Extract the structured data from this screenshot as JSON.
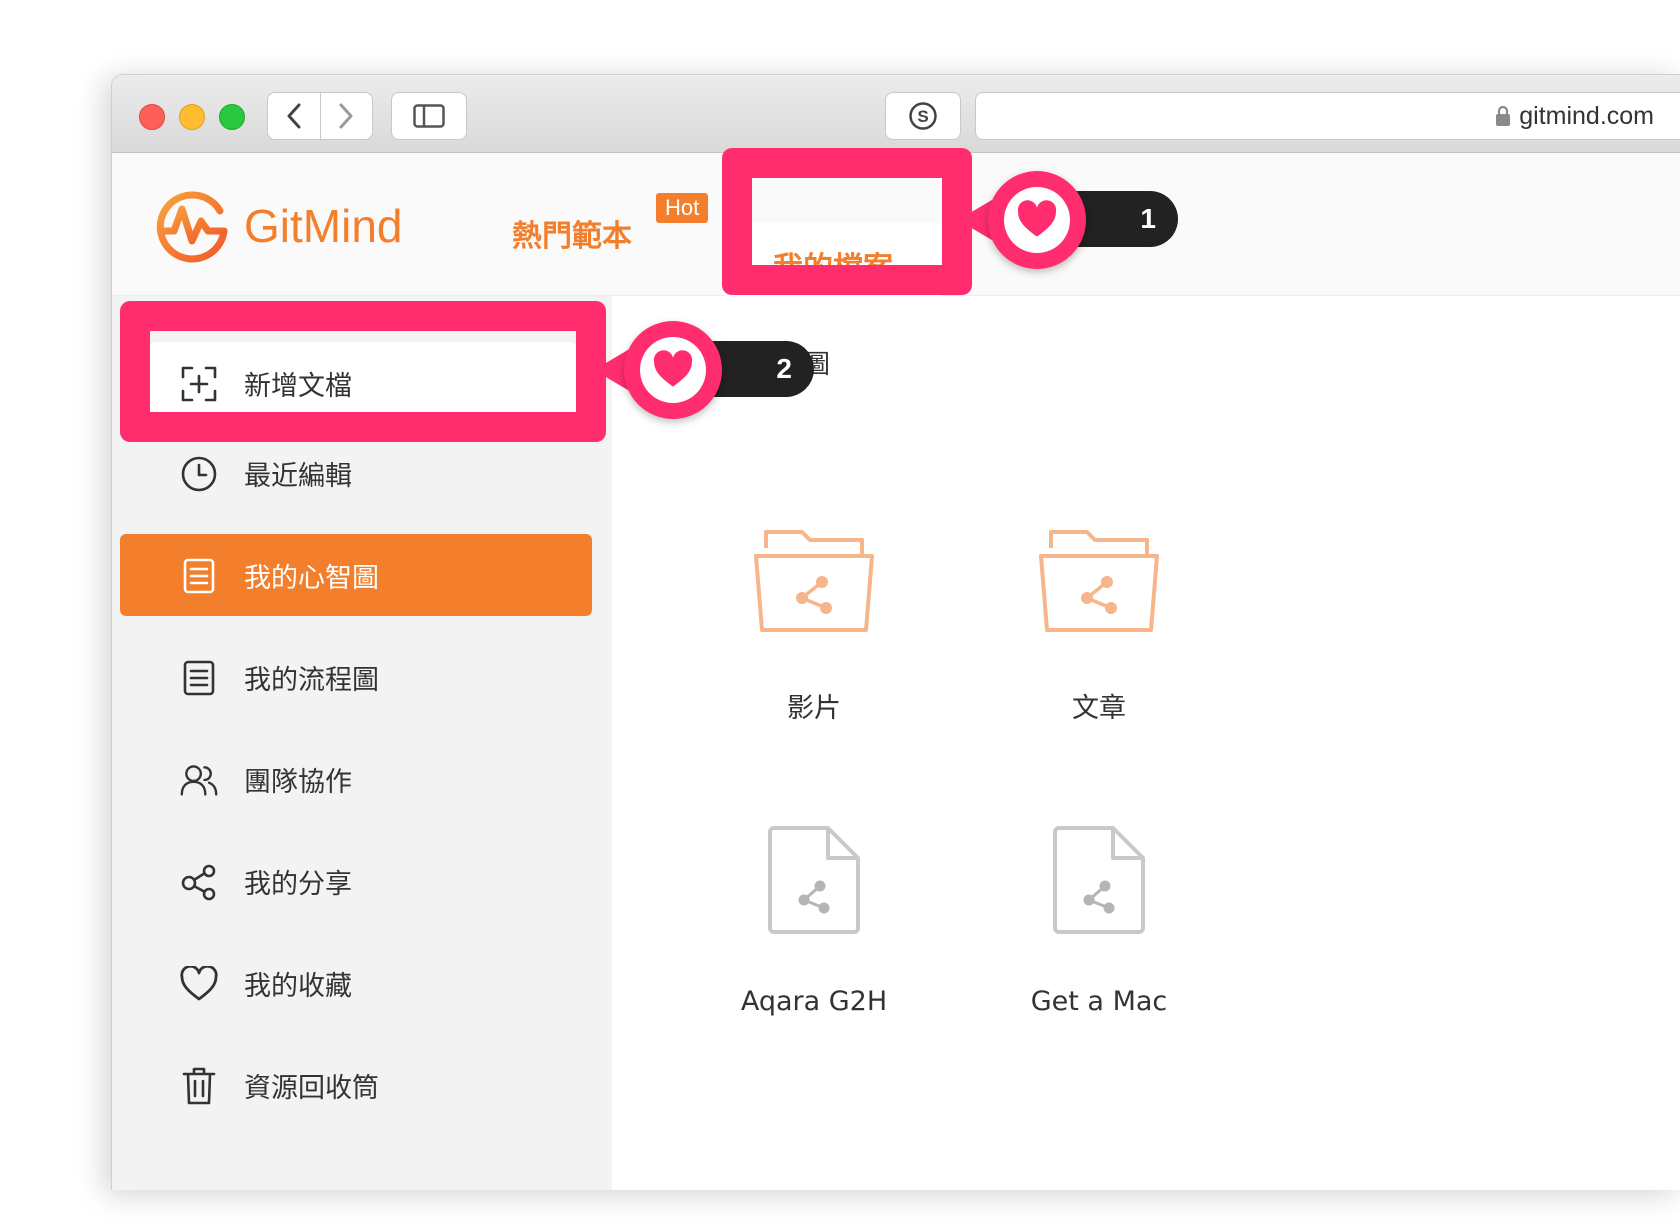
{
  "browser": {
    "url": "gitmind.com"
  },
  "app": {
    "logo_text": "GitMind",
    "nav": {
      "templates": "熱門範本",
      "hot_badge": "Hot",
      "my_files": "我的檔案"
    }
  },
  "sidebar": {
    "new_doc": "新增文檔",
    "items": [
      {
        "label": "最近編輯",
        "icon": "clock-icon"
      },
      {
        "label": "我的心智圖",
        "icon": "document-icon",
        "active": true
      },
      {
        "label": "我的流程圖",
        "icon": "document-icon"
      },
      {
        "label": "團隊協作",
        "icon": "team-icon"
      },
      {
        "label": "我的分享",
        "icon": "share-icon"
      },
      {
        "label": "我的收藏",
        "icon": "heart-icon"
      },
      {
        "label": "資源回收筒",
        "icon": "trash-icon"
      }
    ]
  },
  "content": {
    "breadcrumb": "心智圖",
    "folders": [
      {
        "label": "影片"
      },
      {
        "label": "文章"
      }
    ],
    "files": [
      {
        "label": "Aqara G2H"
      },
      {
        "label": "Get a Mac"
      }
    ]
  },
  "annotations": {
    "step1": "1",
    "step2": "2"
  },
  "colors": {
    "brand_orange": "#f37f2c",
    "highlight_pink": "#ff2d6e",
    "folder_tint": "#f6b58a"
  }
}
